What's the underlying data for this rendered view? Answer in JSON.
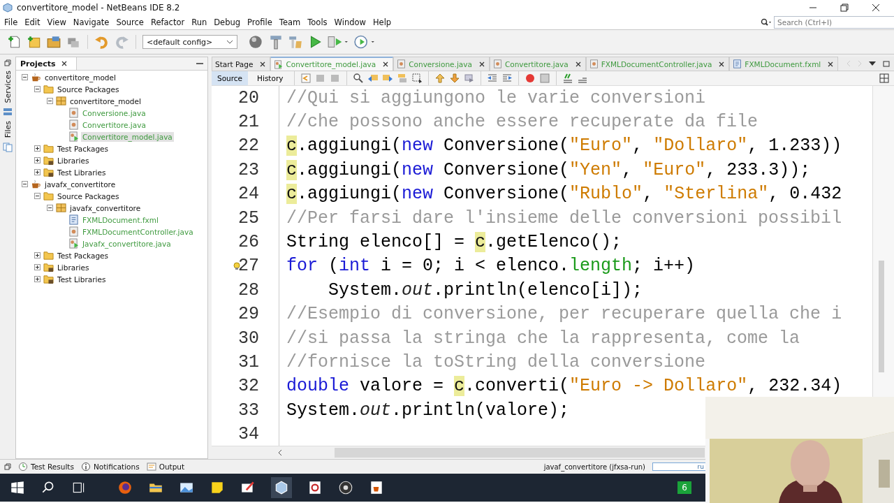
{
  "window": {
    "title": "convertitore_model - NetBeans IDE 8.2"
  },
  "menu": [
    "File",
    "Edit",
    "View",
    "Navigate",
    "Source",
    "Refactor",
    "Run",
    "Debug",
    "Profile",
    "Team",
    "Tools",
    "Window",
    "Help"
  ],
  "config_select": {
    "value": "<default config>"
  },
  "search": {
    "placeholder": "Search (Ctrl+I)"
  },
  "side_tabs": [
    "Services",
    "Files"
  ],
  "projects": {
    "title": "Projects",
    "tree": [
      {
        "label": "convertitore_model",
        "kind": "project",
        "expanded": true,
        "selected": false,
        "children": [
          {
            "label": "Source Packages",
            "kind": "folder",
            "expanded": true,
            "selected": false,
            "children": [
              {
                "label": "convertitore_model",
                "kind": "package",
                "expanded": true,
                "selected": false,
                "children": [
                  {
                    "label": "Conversione.java",
                    "kind": "java",
                    "selected": false
                  },
                  {
                    "label": "Convertitore.java",
                    "kind": "java",
                    "selected": false
                  },
                  {
                    "label": "Convertitore_model.java",
                    "kind": "main",
                    "selected": true
                  }
                ]
              }
            ]
          },
          {
            "label": "Test Packages",
            "kind": "folder",
            "expanded": false,
            "selected": false
          },
          {
            "label": "Libraries",
            "kind": "library",
            "expanded": false,
            "selected": false
          },
          {
            "label": "Test Libraries",
            "kind": "library",
            "expanded": false,
            "selected": false
          }
        ]
      },
      {
        "label": "javafx_convertitore",
        "kind": "project",
        "expanded": true,
        "selected": false,
        "children": [
          {
            "label": "Source Packages",
            "kind": "folder",
            "expanded": true,
            "selected": false,
            "children": [
              {
                "label": "javafx_convertitore",
                "kind": "package",
                "expanded": true,
                "selected": false,
                "children": [
                  {
                    "label": "FXMLDocument.fxml",
                    "kind": "fxml",
                    "selected": false
                  },
                  {
                    "label": "FXMLDocumentController.java",
                    "kind": "java",
                    "selected": false
                  },
                  {
                    "label": "Javafx_convertitore.java",
                    "kind": "main",
                    "selected": false
                  }
                ]
              }
            ]
          },
          {
            "label": "Test Packages",
            "kind": "folder",
            "expanded": false,
            "selected": false
          },
          {
            "label": "Libraries",
            "kind": "library",
            "expanded": false,
            "selected": false
          },
          {
            "label": "Test Libraries",
            "kind": "library",
            "expanded": false,
            "selected": false
          }
        ]
      }
    ]
  },
  "editor": {
    "tabs": [
      {
        "label": "Start Page",
        "kind": "page",
        "selected": false
      },
      {
        "label": "Convertitore_model.java",
        "kind": "main",
        "selected": true
      },
      {
        "label": "Conversione.java",
        "kind": "java",
        "selected": false
      },
      {
        "label": "Convertitore.java",
        "kind": "java",
        "selected": false
      },
      {
        "label": "FXMLDocumentController.java",
        "kind": "java",
        "selected": false
      },
      {
        "label": "FXMLDocument.fxml",
        "kind": "fxml",
        "selected": false
      }
    ],
    "views": [
      {
        "label": "Source",
        "selected": true
      },
      {
        "label": "History",
        "selected": false
      }
    ],
    "lines": [
      {
        "number": "20",
        "tokens": [
          {
            "kind": "comment",
            "text": "//Qui si aggiungono le varie conversioni"
          }
        ]
      },
      {
        "number": "21",
        "tokens": [
          {
            "kind": "comment",
            "text": "//che possono anche essere recuperate da file"
          }
        ]
      },
      {
        "number": "22",
        "tokens": [
          {
            "kind": "mark",
            "text": "c"
          },
          {
            "kind": "text",
            "text": ".aggiungi("
          },
          {
            "kind": "keyword",
            "text": "new"
          },
          {
            "kind": "text",
            "text": " Conversione("
          },
          {
            "kind": "string",
            "text": "\"Euro\""
          },
          {
            "kind": "text",
            "text": ", "
          },
          {
            "kind": "string",
            "text": "\"Dollaro\""
          },
          {
            "kind": "text",
            "text": ", 1.233))"
          }
        ]
      },
      {
        "number": "23",
        "tokens": [
          {
            "kind": "mark",
            "text": "c"
          },
          {
            "kind": "text",
            "text": ".aggiungi("
          },
          {
            "kind": "keyword",
            "text": "new"
          },
          {
            "kind": "text",
            "text": " Conversione("
          },
          {
            "kind": "string",
            "text": "\"Yen\""
          },
          {
            "kind": "text",
            "text": ", "
          },
          {
            "kind": "string",
            "text": "\"Euro\""
          },
          {
            "kind": "text",
            "text": ", 233.3));"
          }
        ]
      },
      {
        "number": "24",
        "tokens": [
          {
            "kind": "mark",
            "text": "c"
          },
          {
            "kind": "text",
            "text": ".aggiungi("
          },
          {
            "kind": "keyword",
            "text": "new"
          },
          {
            "kind": "text",
            "text": " Conversione("
          },
          {
            "kind": "string",
            "text": "\"Rublo\""
          },
          {
            "kind": "text",
            "text": ", "
          },
          {
            "kind": "string",
            "text": "\"Sterlina\""
          },
          {
            "kind": "text",
            "text": ", 0.432"
          }
        ]
      },
      {
        "number": "25",
        "tokens": [
          {
            "kind": "comment",
            "text": "//Per farsi dare l'insieme delle conversioni possibil"
          }
        ]
      },
      {
        "number": "26",
        "tokens": [
          {
            "kind": "text",
            "text": "String elenco[] = "
          },
          {
            "kind": "mark",
            "text": "c"
          },
          {
            "kind": "text",
            "text": ".getElenco();"
          }
        ]
      },
      {
        "number": "27",
        "hint": true,
        "tokens": [
          {
            "kind": "keyword",
            "text": "for"
          },
          {
            "kind": "text",
            "text": " ("
          },
          {
            "kind": "keyword",
            "text": "int"
          },
          {
            "kind": "text",
            "text": " i = 0; i < elenco."
          },
          {
            "kind": "member",
            "text": "length"
          },
          {
            "kind": "text",
            "text": "; i++)"
          }
        ]
      },
      {
        "number": "28",
        "tokens": [
          {
            "kind": "text",
            "text": "    System."
          },
          {
            "kind": "field",
            "text": "out"
          },
          {
            "kind": "text",
            "text": ".println(elenco[i]);"
          }
        ]
      },
      {
        "number": "29",
        "tokens": [
          {
            "kind": "comment",
            "text": "//Esempio di conversione, per recuperare quella che i"
          }
        ]
      },
      {
        "number": "30",
        "tokens": [
          {
            "kind": "comment",
            "text": "//si passa la stringa che la rappresenta, come la"
          }
        ]
      },
      {
        "number": "31",
        "tokens": [
          {
            "kind": "comment",
            "text": "//fornisce la toString della conversione"
          }
        ]
      },
      {
        "number": "32",
        "tokens": [
          {
            "kind": "keyword",
            "text": "double"
          },
          {
            "kind": "text",
            "text": " valore = "
          },
          {
            "kind": "mark",
            "text": "c"
          },
          {
            "kind": "text",
            "text": ".converti("
          },
          {
            "kind": "string",
            "text": "\"Euro -> Dollaro\""
          },
          {
            "kind": "text",
            "text": ", 232.34)"
          }
        ]
      },
      {
        "number": "33",
        "tokens": [
          {
            "kind": "text",
            "text": "System."
          },
          {
            "kind": "field",
            "text": "out"
          },
          {
            "kind": "text",
            "text": ".println(valore);"
          }
        ]
      },
      {
        "number": "34"
      }
    ]
  },
  "bottom_tabs": [
    "Test Results",
    "Notifications",
    "Output"
  ],
  "status": {
    "task": "javaf_convertitore (jfxsa-run)",
    "progress_text": "ru"
  },
  "taskbar": {
    "tray_text": "6"
  },
  "webcam": {
    "kind": "picture"
  }
}
